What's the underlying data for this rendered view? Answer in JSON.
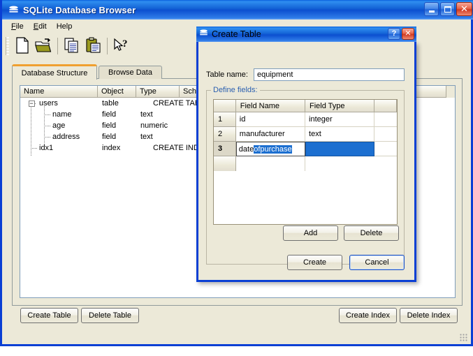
{
  "app": {
    "title": "SQLite Database Browser",
    "icon": "database-icon",
    "window_buttons": [
      {
        "name": "minimize",
        "glyph": "minimize-icon"
      },
      {
        "name": "maximize",
        "glyph": "maximize-icon"
      },
      {
        "name": "close",
        "glyph": "close-icon"
      }
    ]
  },
  "menu": [
    {
      "label": "File",
      "accel": "F"
    },
    {
      "label": "Edit",
      "accel": "E"
    },
    {
      "label": "Help",
      "accel": ""
    }
  ],
  "toolbar": [
    {
      "name": "new-database-icon",
      "tip": "New Database"
    },
    {
      "name": "open-database-icon",
      "tip": "Open Database"
    },
    {
      "name": "copy-icon",
      "tip": "Copy"
    },
    {
      "name": "paste-icon",
      "tip": "Paste"
    },
    {
      "name": "whats-this-icon",
      "tip": "What's This?"
    }
  ],
  "tabs": [
    {
      "label": "Database Structure",
      "active": true
    },
    {
      "label": "Browse Data",
      "active": false
    }
  ],
  "tree": {
    "columns": [
      "Name",
      "Object",
      "Type",
      "Schema"
    ],
    "rows": [
      {
        "name": "users",
        "object": "table",
        "type": "",
        "schema": "CREATE TAB",
        "level": 0,
        "expanded": true
      },
      {
        "name": "name",
        "object": "field",
        "type": "text",
        "schema": "",
        "level": 1
      },
      {
        "name": "age",
        "object": "field",
        "type": "numeric",
        "schema": "",
        "level": 1
      },
      {
        "name": "address",
        "object": "field",
        "type": "text",
        "schema": "",
        "level": 1
      },
      {
        "name": "idx1",
        "object": "index",
        "type": "",
        "schema": "CREATE IND",
        "level": 0
      }
    ]
  },
  "bottom_buttons": {
    "create_table": "Create Table",
    "delete_table": "Delete Table",
    "create_index": "Create Index",
    "delete_index": "Delete Index"
  },
  "dialog": {
    "title": "Create Table",
    "icon": "database-icon",
    "help_button": "?",
    "close_button": "✕",
    "table_name_label": "Table name:",
    "table_name_value": "equipment",
    "group_title": "Define fields:",
    "grid": {
      "columns": [
        "Field Name",
        "Field Type"
      ],
      "rows": [
        {
          "num": "1",
          "field_name": "id",
          "field_type": "integer"
        },
        {
          "num": "2",
          "field_name": "manufacturer",
          "field_type": "text"
        },
        {
          "num": "3",
          "field_name": "date",
          "field_name_selected": "ofpurchase",
          "field_type": "",
          "editing": true,
          "current": true,
          "type_selected": true
        }
      ]
    },
    "add_label": "Add",
    "delete_label": "Delete",
    "create_label": "Create",
    "cancel_label": "Cancel"
  },
  "colors": {
    "titlebar_blue": "#0c4fd0",
    "window_border": "#0a3fd4",
    "face": "#ece9d8",
    "selection_blue": "#1c6fd0",
    "active_tab_accent": "#f0a030",
    "group_label": "#2b60b0"
  }
}
